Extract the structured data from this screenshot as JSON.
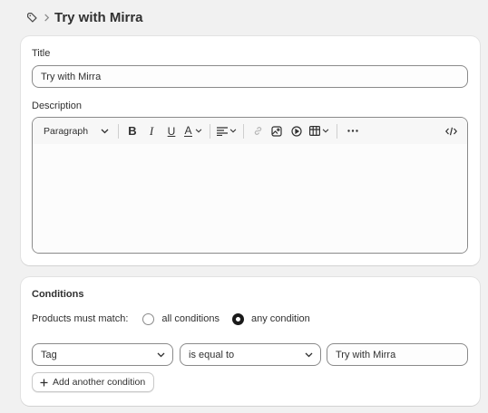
{
  "header": {
    "icon": "tag-icon",
    "page_title": "Try with Mirra"
  },
  "details": {
    "title_label": "Title",
    "title_value": "Try with Mirra",
    "description_label": "Description",
    "toolbar": {
      "paragraph_label": "Paragraph",
      "bold_glyph": "B",
      "italic_glyph": "I",
      "underline_glyph": "U",
      "text_color_glyph": "A"
    }
  },
  "conditions": {
    "section_title": "Conditions",
    "match_label": "Products must match:",
    "options": [
      "all conditions",
      "any condition"
    ],
    "selected_option": "any condition",
    "rule": {
      "field": "Tag",
      "operator": "is equal to",
      "value": "Try with Mirra"
    },
    "add_button_label": "Add another condition"
  }
}
